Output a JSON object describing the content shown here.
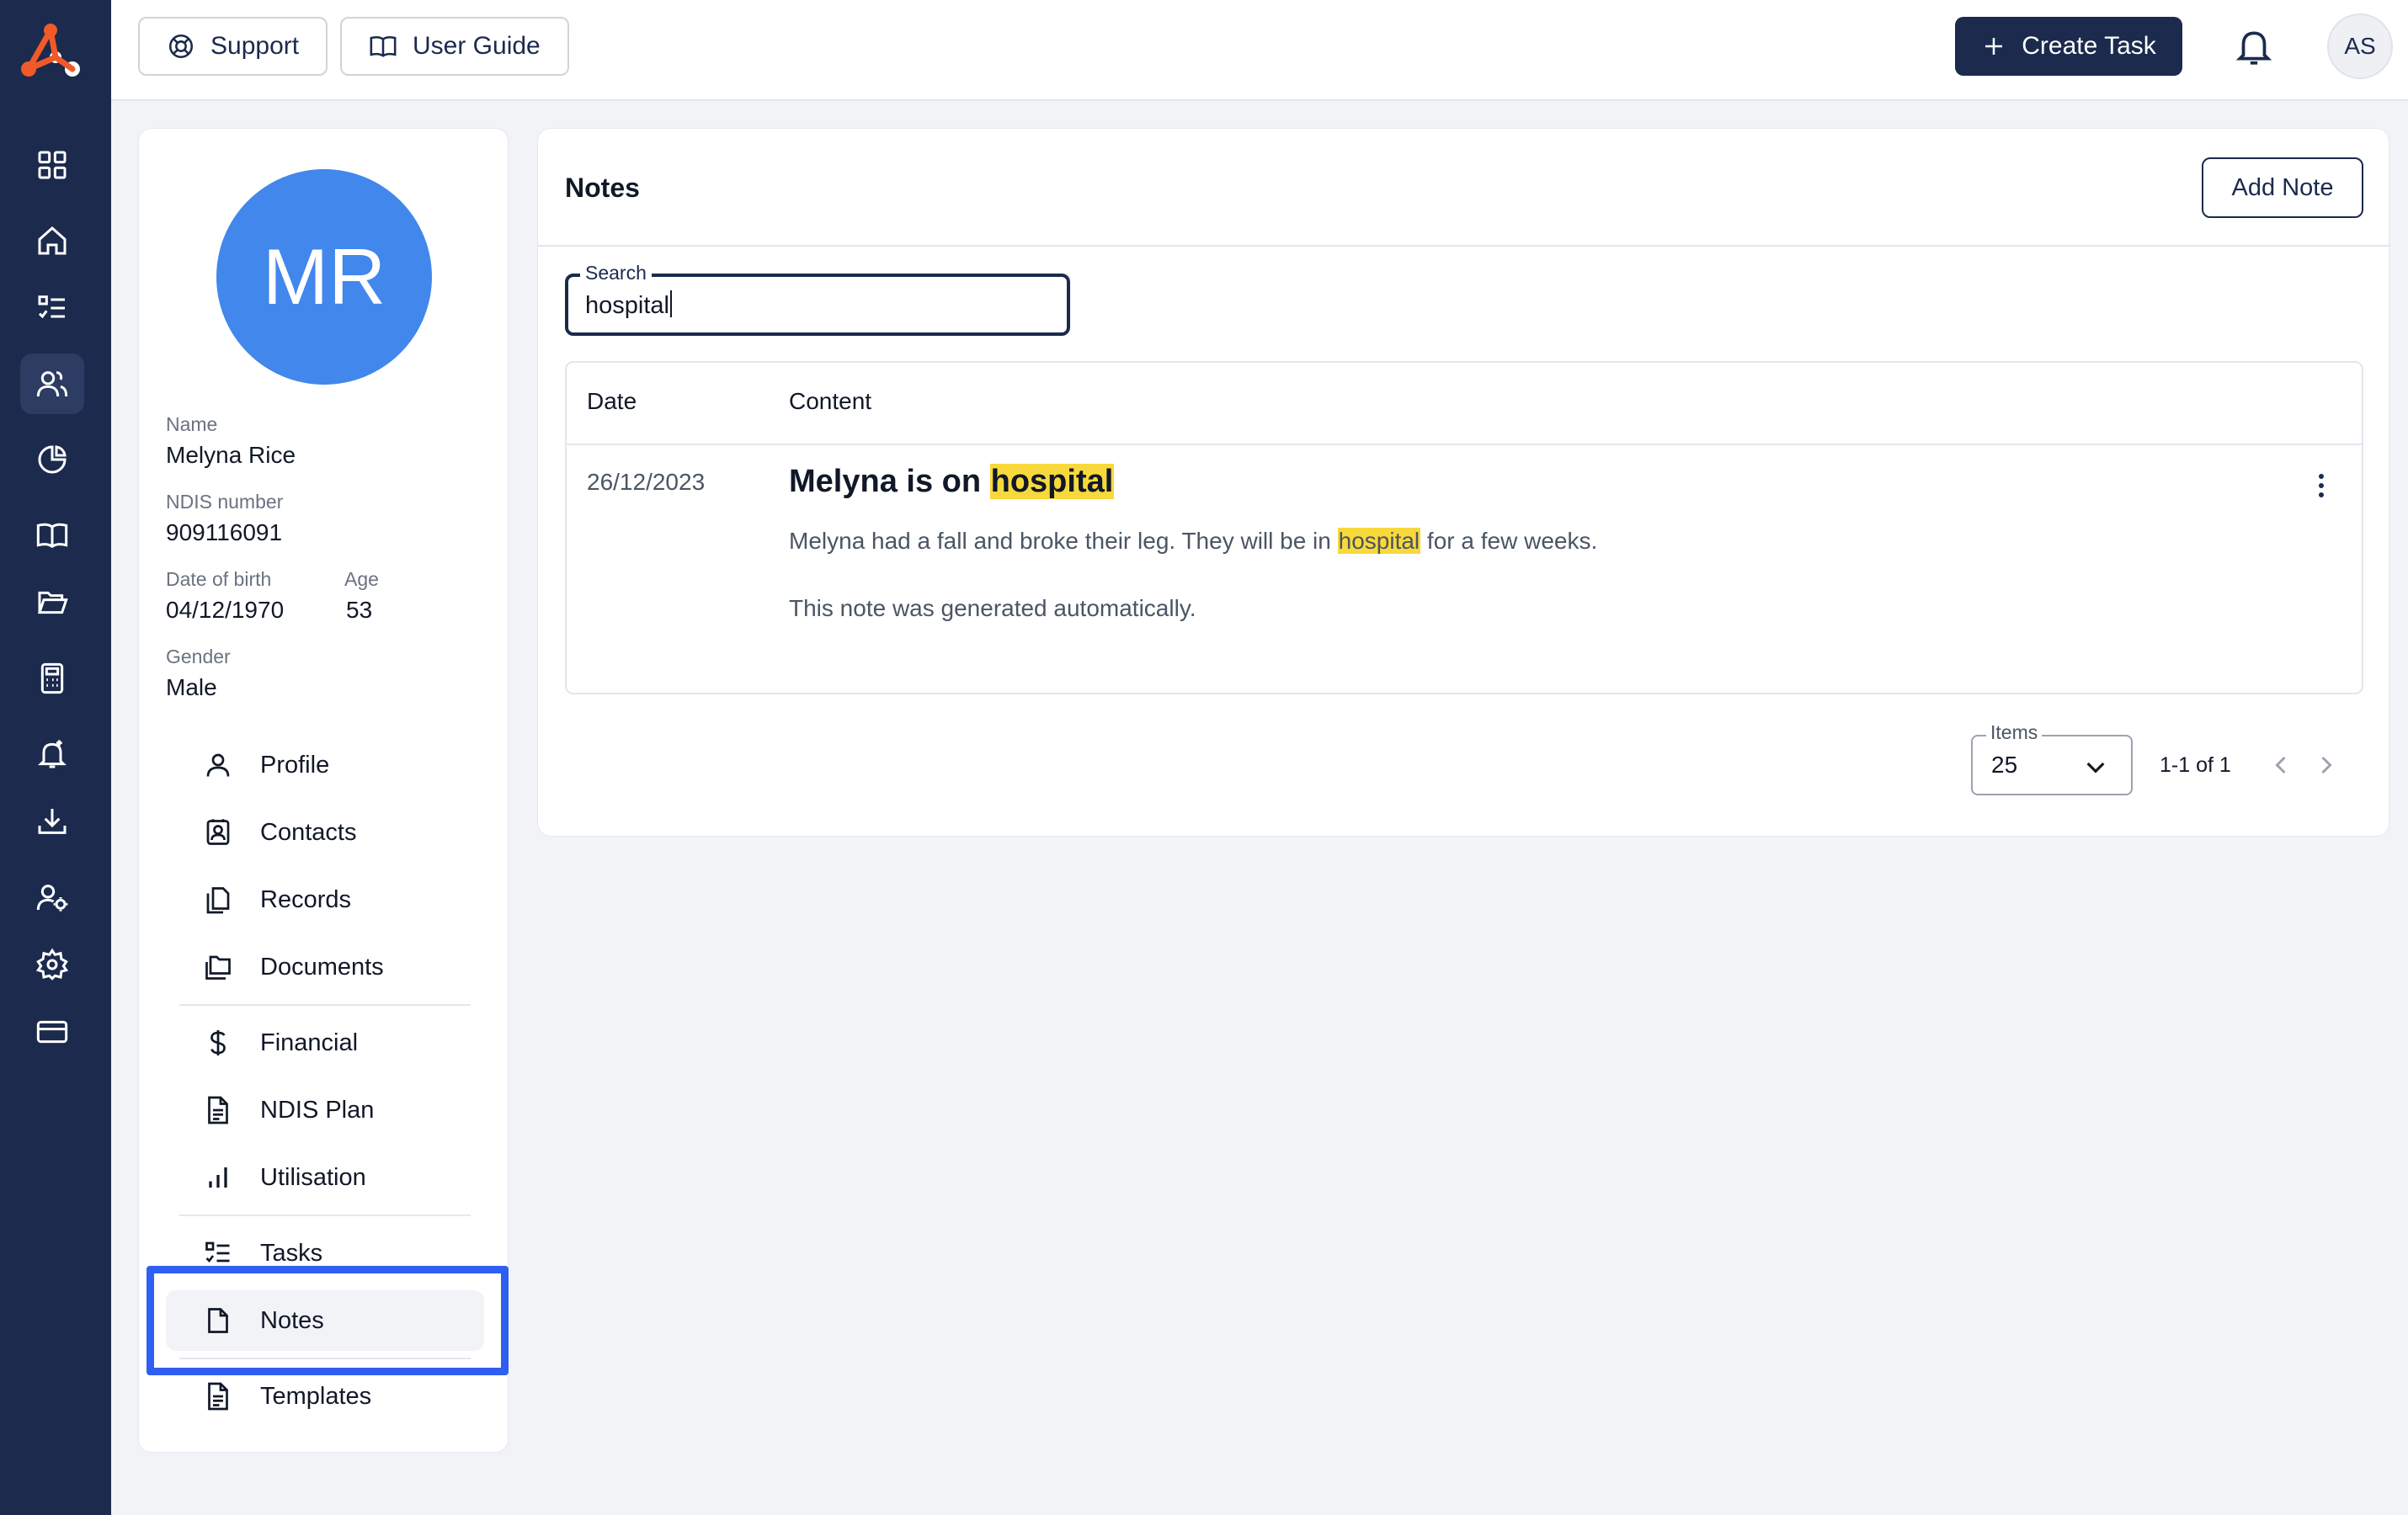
{
  "topbar": {
    "support_label": "Support",
    "user_guide_label": "User Guide",
    "create_task_label": "Create Task",
    "user_initials": "AS"
  },
  "rail": {
    "items": [
      "dashboard-icon",
      "home-icon",
      "task-list-icon",
      "participants-icon",
      "chart-pie-icon",
      "book-icon",
      "folder-open-icon",
      "calculator-icon",
      "bell-plus-icon",
      "download-icon",
      "user-settings-icon",
      "gear-icon",
      "credit-card-icon"
    ],
    "active_index": 3
  },
  "profile": {
    "initials": "MR",
    "name_label": "Name",
    "name": "Melyna Rice",
    "ndis_label": "NDIS number",
    "ndis": "909116091",
    "dob_label": "Date of birth",
    "dob": "04/12/1970",
    "age_label": "Age",
    "age": "53",
    "gender_label": "Gender",
    "gender": "Male"
  },
  "menu": {
    "profile": "Profile",
    "contacts": "Contacts",
    "records": "Records",
    "documents": "Documents",
    "financial": "Financial",
    "ndis_plan": "NDIS Plan",
    "utilisation": "Utilisation",
    "tasks": "Tasks",
    "notes": "Notes",
    "templates": "Templates",
    "active": "Notes"
  },
  "notes": {
    "title": "Notes",
    "add_label": "Add Note",
    "search_label": "Search",
    "search_value": "hospital",
    "columns": {
      "date": "Date",
      "content": "Content"
    },
    "rows": [
      {
        "date": "26/12/2023",
        "title_pre": "Melyna is on ",
        "title_hl": "hospital",
        "body_pre": "Melyna had a fall and broke their leg. They will be in ",
        "body_hl": "hospital",
        "body_post": " for a few weeks.",
        "footer": "This note was generated automatically."
      }
    ],
    "pagination": {
      "items_label": "Items",
      "items_value": "25",
      "range": "1-1 of 1"
    }
  },
  "colors": {
    "rail_bg": "#1b2a4d",
    "accent": "#1b2a4d",
    "avatar_bg": "#4287ec",
    "highlight": "#f8d93c",
    "annotation_box": "#2f5ff0",
    "logo": "#f05a28"
  }
}
